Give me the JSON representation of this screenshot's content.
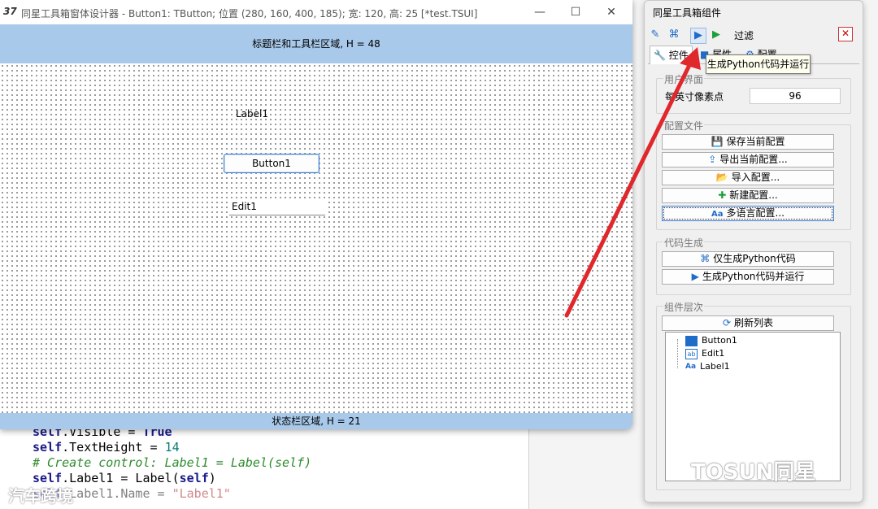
{
  "background_code": {
    "line1": {
      "a": "self",
      "b": ".Visible = ",
      "c": "True"
    },
    "line2": {
      "a": "self",
      "b": ".TextHeight = ",
      "c": "14"
    },
    "line3": "# Create control: Label1 = Label(self)",
    "line4": {
      "a": "self",
      "b": ".Label1 = Label(",
      "c": "self",
      "d": ")"
    },
    "line5": {
      "a": "self",
      "b": ".Label1.Name = ",
      "c": "\"Label1\""
    }
  },
  "designer": {
    "logo": "37",
    "title": "同星工具箱窗体设计器 - Button1: TButton; 位置 (280, 160, 400, 185); 宽: 120, 高: 25 [*test.TSUI]",
    "minimize": "—",
    "maximize": "☐",
    "close": "✕",
    "title_toolbar_area": "标题栏和工具栏区域, H = 48",
    "status_area": "状态栏区域, H = 21",
    "controls": {
      "label1": "Label1",
      "button1": "Button1",
      "edit1": "Edit1"
    }
  },
  "panel": {
    "title": "同星工具箱组件",
    "toolbar": {
      "edit_icon": "✎",
      "python_icon": "⌘",
      "run_icon": "▶",
      "run2_icon": "▶",
      "filter_label": "过滤",
      "filter_close": "✕"
    },
    "tabs": [
      {
        "label": "控件"
      },
      {
        "label": "属性"
      },
      {
        "label": "配置"
      }
    ],
    "ui_group": {
      "title": "用户界面",
      "pixel_label": "每英寸像素点",
      "pixel_value": "96"
    },
    "config_group": {
      "title": "配置文件",
      "buttons": [
        "保存当前配置",
        "导出当前配置...",
        "导入配置...",
        "新建配置...",
        "多语言配置..."
      ]
    },
    "codegen_group": {
      "title": "代码生成",
      "buttons": [
        "仅生成Python代码",
        "生成Python代码并运行"
      ]
    },
    "hierarchy_group": {
      "title": "组件层次",
      "refresh": "刷新列表",
      "items": [
        "Button1",
        "Edit1",
        "Label1"
      ],
      "item_icons": [
        "button-icon",
        "edit-icon",
        "label-icon"
      ]
    }
  },
  "tooltip": "生成Python代码并运行",
  "watermarks": {
    "right": "TOSUN同星",
    "left": "汽车跨境"
  },
  "colors": {
    "band": "#a8c9ea",
    "arrow": "#e0282c",
    "accent": "#1e6cc7"
  }
}
